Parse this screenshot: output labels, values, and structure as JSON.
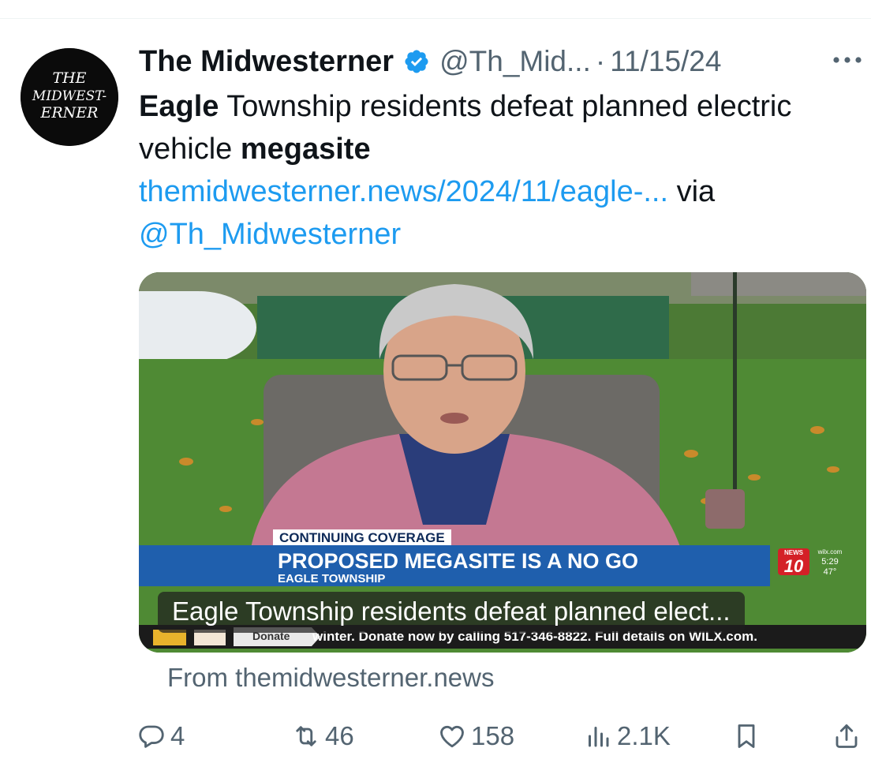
{
  "author": {
    "name": "The Midwesterner",
    "handle": "@Th_Mid...",
    "separator": "·",
    "date": "11/15/24",
    "avatar_text": [
      "THE",
      "MIDWEST-",
      "ERNER"
    ]
  },
  "tweet": {
    "w1": "Eagle",
    "t1": " Township residents defeat planned electric vehicle ",
    "w2": "megasite",
    "link": "themidwesterner.news/2024/11/eagle-...",
    "via": " via",
    "mention": "@Th_Midwesterner"
  },
  "media": {
    "overlay_tag": "CONTINUING COVERAGE",
    "overlay_headline": "PROPOSED MEGASITE IS A NO GO",
    "overlay_location": "EAGLE TOWNSHIP",
    "station_logo_top": "NEWS",
    "station_logo_num": "10",
    "weather_brand": "wilx.com",
    "weather_time": "5:29",
    "weather_temp": "47°",
    "ticker_donate": "Donate",
    "ticker_text": "winter.  Donate now by calling 517-346-8822.  Full details on WILX.com.",
    "caption": "Eagle Township residents defeat planned elect..."
  },
  "card_source": "From themidwesterner.news",
  "actions": {
    "replies": "4",
    "reposts": "46",
    "likes": "158",
    "views": "2.1K"
  },
  "colors": {
    "link": "#1d9bf0",
    "verified": "#1d9bf0",
    "secondary_text": "#536471",
    "banner_blue": "#1f5fad"
  }
}
